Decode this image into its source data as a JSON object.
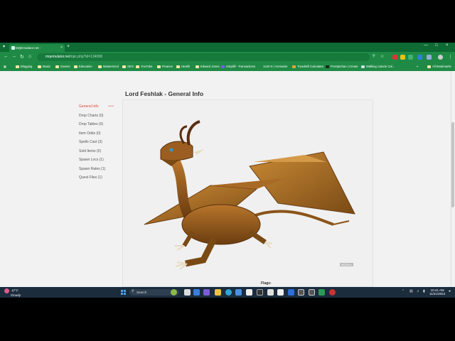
{
  "browser": {
    "tab_title": "MQEmulator.net - ",
    "new_tab": "+",
    "url_host": "mqemulator.net",
    "url_path": "/npc.php?id=134008",
    "bookmarks": [
      "Blogging",
      "Music",
      "Games",
      "Education",
      "Mastermind",
      "SEO",
      "YouTube",
      "Finance",
      "Health",
      "Edward Jones",
      "Simplifi - Transactions",
      "1140 ☰ | Komodor",
      "Treadmill Calculator",
      "Promptchan | Create",
      "Walking Calorie Cal...",
      "All Bookmarks"
    ],
    "more_bookmarks": "»"
  },
  "page": {
    "title": "Lord Feshlak - General Info",
    "menu": [
      {
        "label": "General Info",
        "active": true
      },
      {
        "label": "Drop Charts (0)"
      },
      {
        "label": "Drop Tables (0)"
      },
      {
        "label": "Item Odds (0)"
      },
      {
        "label": "Spells Cast (3)"
      },
      {
        "label": "Sold Items (0)"
      },
      {
        "label": "Spawn Locs (1)"
      },
      {
        "label": "Spawn Rates (1)"
      },
      {
        "label": "Quest Files (1)"
      }
    ],
    "active_marker": "•••",
    "watermark": "MQEmu",
    "flags_label": "Flags:"
  },
  "taskbar": {
    "temp": "47°F",
    "condition": "Cloudy",
    "search_placeholder": "Search",
    "time": "10:41 AM",
    "date": "11/21/2024"
  },
  "colors": {
    "chrome_green": "#1f8a45",
    "accent_red": "#e0473c",
    "taskbar": "#1b2c3d"
  }
}
